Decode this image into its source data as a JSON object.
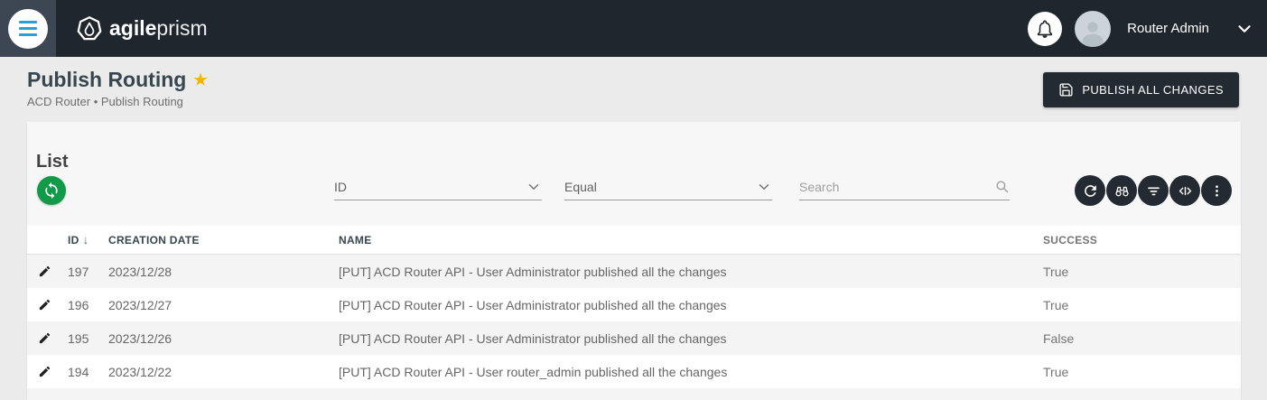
{
  "navbar": {
    "brand_bold": "agile",
    "brand_light": "prism",
    "user_name": "Router Admin"
  },
  "header": {
    "title": "Publish Routing",
    "favorite_star": "★",
    "breadcrumb": "ACD Router • Publish Routing",
    "publish_button": "PUBLISH ALL CHANGES"
  },
  "list": {
    "title": "List",
    "filter_field": "ID",
    "filter_operator": "Equal",
    "search_placeholder": "Search",
    "toolbar_icons": [
      "refresh-icon",
      "binoculars-icon",
      "filter-icon",
      "code-icon",
      "more-vert-icon"
    ]
  },
  "table": {
    "columns": [
      "ID",
      "CREATION DATE",
      "NAME",
      "SUCCESS"
    ],
    "sort_arrow": "↓",
    "rows": [
      {
        "id": "197",
        "creation_date": "2023/12/28",
        "name": "[PUT] ACD Router API - User Administrator published all the changes",
        "success": "True"
      },
      {
        "id": "196",
        "creation_date": "2023/12/27",
        "name": "[PUT] ACD Router API - User Administrator published all the changes",
        "success": "True"
      },
      {
        "id": "195",
        "creation_date": "2023/12/26",
        "name": "[PUT] ACD Router API - User Administrator published all the changes",
        "success": "False"
      },
      {
        "id": "194",
        "creation_date": "2023/12/22",
        "name": "[PUT] ACD Router API - User router_admin published all the changes",
        "success": "True"
      }
    ]
  },
  "colors": {
    "navbar_bg": "#20262d",
    "menu_square_bg": "#3c4753",
    "hamburger_blue": "#2b9fd8",
    "accent_green": "#119b48",
    "dark_button": "#232a31",
    "title_text": "#37474f",
    "star_gold": "#f2b600",
    "page_bg": "#ebebeb",
    "stripe_row": "#f4f4f4"
  }
}
